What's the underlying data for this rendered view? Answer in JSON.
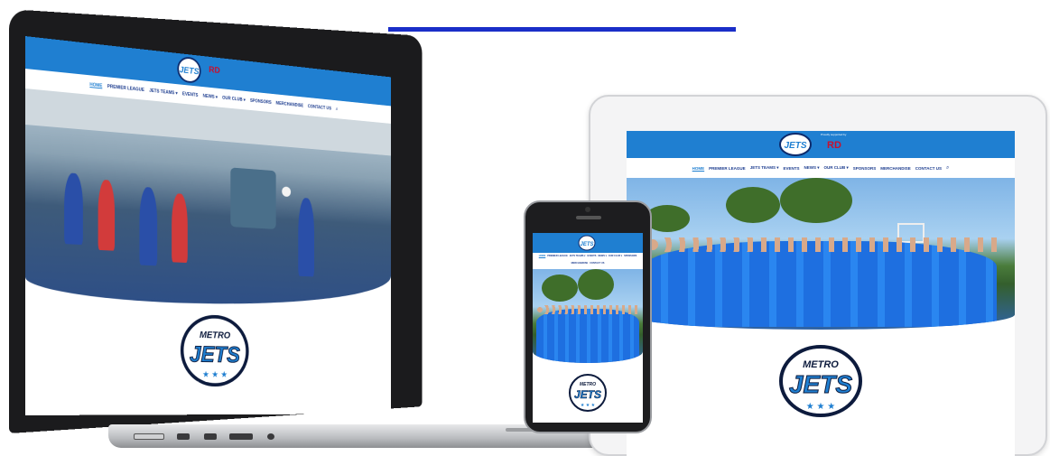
{
  "site": {
    "brand_word": "JETS",
    "brand_small": "METRO",
    "sponsor_name": "RD",
    "sponsor_tag": "Proudly supported by",
    "nav": [
      {
        "label": "HOME",
        "active": true
      },
      {
        "label": "PREMIER LEAGUE",
        "active": false
      },
      {
        "label": "JETS TEAMS ▾",
        "active": false
      },
      {
        "label": "EVENTS",
        "active": false
      },
      {
        "label": "NEWS ▾",
        "active": false
      },
      {
        "label": "OUR CLUB ▾",
        "active": false
      },
      {
        "label": "SPONSORS",
        "active": false
      },
      {
        "label": "MERCHANDISE",
        "active": false
      },
      {
        "label": "CONTACT US",
        "active": false
      }
    ],
    "search_icon": "search-icon"
  },
  "colors": {
    "accent_line": "#1a2ec8",
    "header_blue": "#1f7fd1",
    "nav_text": "#1d3d8f",
    "jersey_blue": "#1e6fe0"
  }
}
